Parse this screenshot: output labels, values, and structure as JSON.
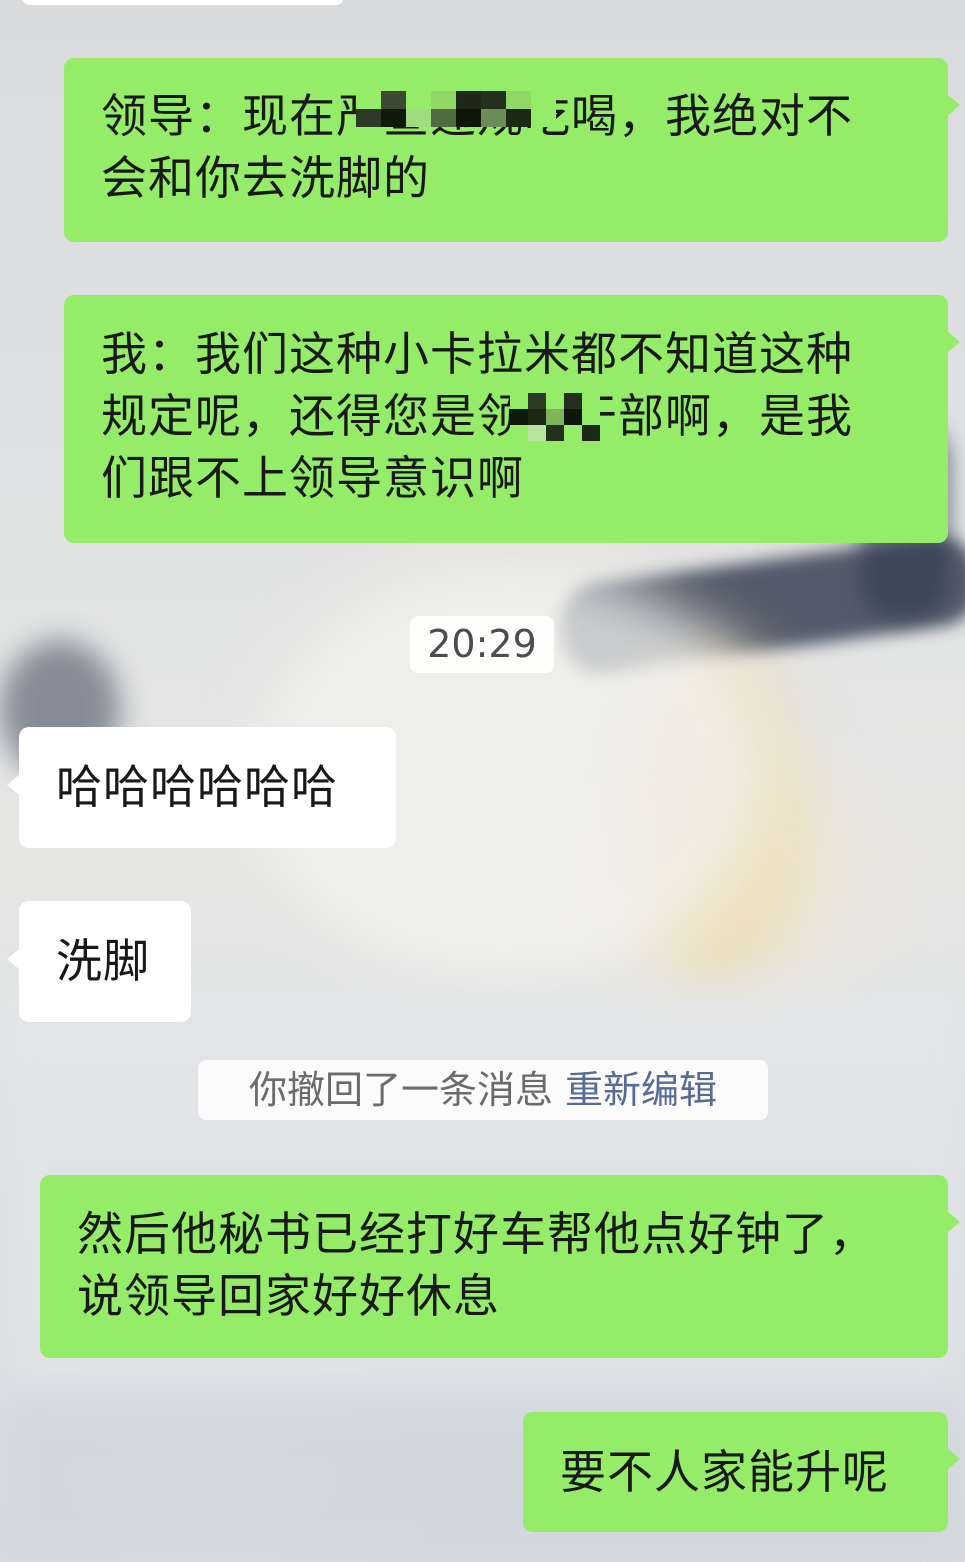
{
  "chat": {
    "messages": [
      {
        "side": "out",
        "text_line1": "领导：现在严查违规吃喝，我绝对不",
        "text_line2": "会和你去洗脚的"
      },
      {
        "side": "out",
        "text_line1": "我：我们这种小卡拉米都不知道这种",
        "text_line2": "规定呢，还得您是领导干部啊，是我",
        "text_line3": "们跟不上领导意识啊"
      },
      {
        "side": "in",
        "text": "哈哈哈哈哈哈"
      },
      {
        "side": "in",
        "text": "洗脚"
      },
      {
        "side": "out",
        "text_line1": "然后他秘书已经打好车帮他点好钟了，",
        "text_line2": "说领导回家好好休息"
      },
      {
        "side": "out",
        "text": "要不人家能升呢"
      }
    ],
    "timestamp": "20:29",
    "recall_notice": {
      "text": "你撤回了一条消息",
      "action": "重新编辑"
    }
  },
  "colors": {
    "outgoing_bubble": "#95ec69",
    "incoming_bubble": "#ffffff",
    "link": "#576b95"
  }
}
